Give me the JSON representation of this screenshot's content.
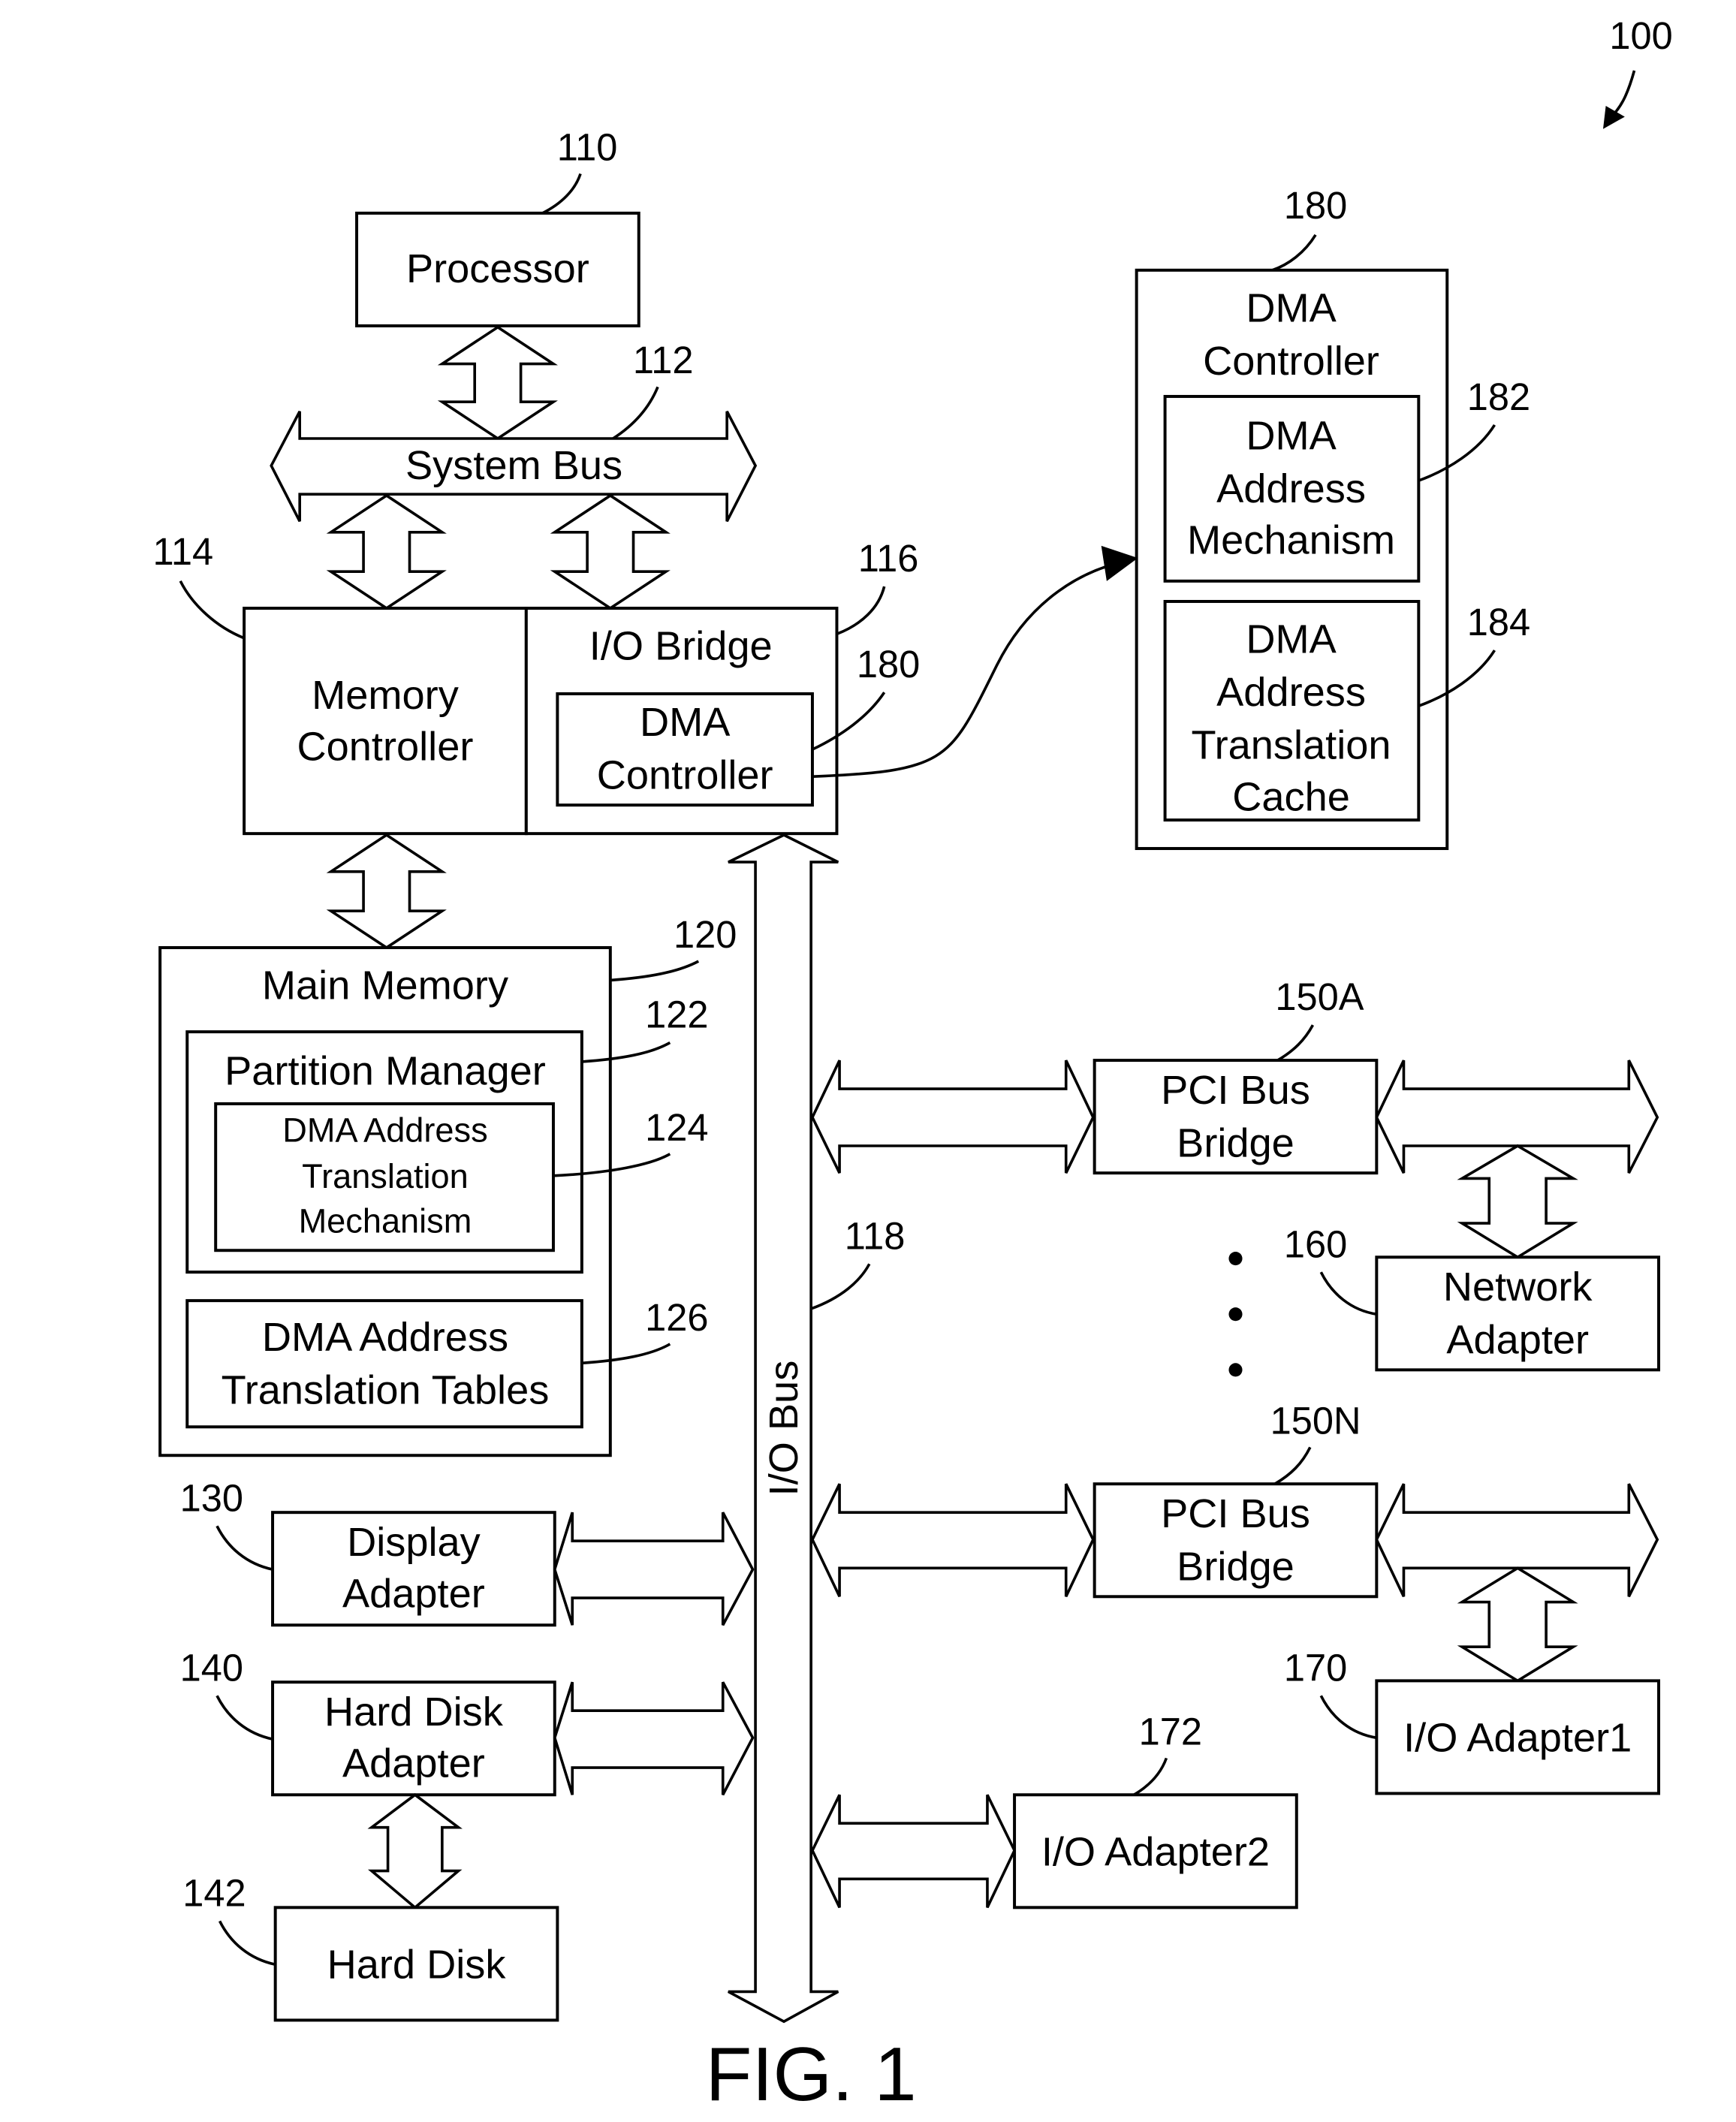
{
  "figure": {
    "caption": "FIG. 1",
    "ref": "100"
  },
  "processor": {
    "label": "Processor",
    "ref": "110"
  },
  "system_bus": {
    "label": "System Bus",
    "ref": "112"
  },
  "memory_controller": {
    "line1": "Memory",
    "line2": "Controller",
    "ref": "114"
  },
  "io_bridge": {
    "label": "I/O Bridge",
    "ref": "116"
  },
  "dma_controller_inner": {
    "line1": "DMA",
    "line2": "Controller",
    "ref": "180"
  },
  "io_bus": {
    "label": "I/O Bus",
    "ref": "118"
  },
  "main_memory": {
    "label": "Main Memory",
    "ref": "120"
  },
  "partition_manager": {
    "label": "Partition Manager",
    "ref": "122"
  },
  "dma_addr_trans_mech": {
    "line1": "DMA Address",
    "line2": "Translation",
    "line3": "Mechanism",
    "ref": "124"
  },
  "dma_addr_trans_tables": {
    "line1": "DMA Address",
    "line2": "Translation Tables",
    "ref": "126"
  },
  "display_adapter": {
    "line1": "Display",
    "line2": "Adapter",
    "ref": "130"
  },
  "hard_disk_adapter": {
    "line1": "Hard Disk",
    "line2": "Adapter",
    "ref": "140"
  },
  "hard_disk": {
    "label": "Hard Disk",
    "ref": "142"
  },
  "pci_bridge_a": {
    "line1": "PCI Bus",
    "line2": "Bridge",
    "ref": "150A"
  },
  "pci_bridge_n": {
    "line1": "PCI Bus",
    "line2": "Bridge",
    "ref": "150N"
  },
  "network_adapter": {
    "line1": "Network",
    "line2": "Adapter",
    "ref": "160"
  },
  "io_adapter1": {
    "label": "I/O Adapter1",
    "ref": "170"
  },
  "io_adapter2": {
    "label": "I/O Adapter2",
    "ref": "172"
  },
  "dma_controller_detail": {
    "line1": "DMA",
    "line2": "Controller",
    "ref": "180",
    "addr_mech": {
      "line1": "DMA",
      "line2": "Address",
      "line3": "Mechanism",
      "ref": "182"
    },
    "trans_cache": {
      "line1": "DMA",
      "line2": "Address",
      "line3": "Translation",
      "line4": "Cache",
      "ref": "184"
    }
  }
}
